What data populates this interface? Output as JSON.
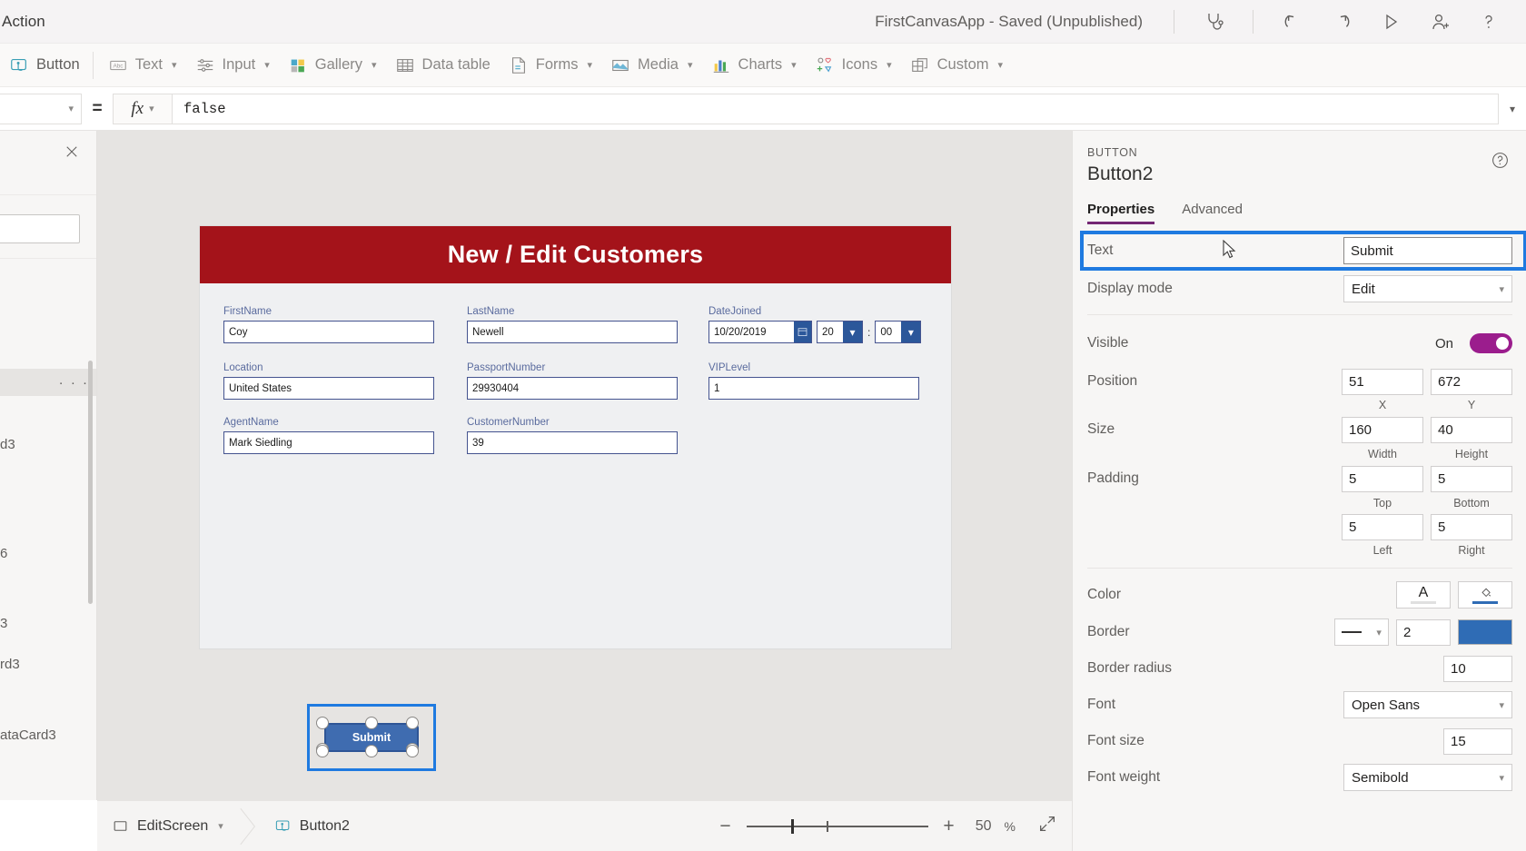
{
  "topbar": {
    "menu_action": "Action",
    "app_title": "FirstCanvasApp - Saved (Unpublished)",
    "icons": [
      {
        "name": "app-checker-icon",
        "label": "App checker"
      },
      {
        "name": "undo-icon",
        "label": "Undo"
      },
      {
        "name": "redo-icon",
        "label": "Redo"
      },
      {
        "name": "preview-play-icon",
        "label": "Preview the app"
      },
      {
        "name": "share-user-icon",
        "label": "Share"
      },
      {
        "name": "help-icon",
        "label": "Help"
      }
    ]
  },
  "ribbon": {
    "items": [
      {
        "label": "Button",
        "icon": "button-icon",
        "caret": false
      },
      {
        "label": "Text",
        "icon": "text-abc-icon",
        "caret": true
      },
      {
        "label": "Input",
        "icon": "input-sliders-icon",
        "caret": true
      },
      {
        "label": "Gallery",
        "icon": "gallery-grid-icon",
        "caret": true
      },
      {
        "label": "Data table",
        "icon": "data-table-icon",
        "caret": false
      },
      {
        "label": "Forms",
        "icon": "forms-icon",
        "caret": true
      },
      {
        "label": "Media",
        "icon": "media-image-icon",
        "caret": true
      },
      {
        "label": "Charts",
        "icon": "charts-bar-icon",
        "caret": true
      },
      {
        "label": "Icons",
        "icon": "icons-shapes-icon",
        "caret": true
      },
      {
        "label": "Custom",
        "icon": "custom-blocks-icon",
        "caret": true
      }
    ]
  },
  "formula_bar": {
    "property": "",
    "equals": "=",
    "fx_label": "fx",
    "value": "false"
  },
  "left_pane": {
    "rows": [
      {
        "label": "",
        "selected": false
      },
      {
        "label": "",
        "selected": true,
        "overflow": "· · ·"
      },
      {
        "label": "d3",
        "selected": false
      },
      {
        "label": "6",
        "selected": false
      },
      {
        "label": "3",
        "selected": false
      },
      {
        "label": "rd3",
        "selected": false
      },
      {
        "label": "ataCard3",
        "selected": false
      }
    ]
  },
  "canvas": {
    "form_title": "New / Edit Customers",
    "header_color": "#a4131a",
    "fields": [
      {
        "label": "FirstName",
        "value": "Coy",
        "type": "text",
        "col": 0,
        "row": 0
      },
      {
        "label": "LastName",
        "value": "Newell",
        "type": "text",
        "col": 1,
        "row": 0
      },
      {
        "label": "DateJoined",
        "value": "10/20/2019",
        "type": "datetime",
        "hour": "20",
        "minute": "00",
        "separator": ":",
        "col": 2,
        "row": 0
      },
      {
        "label": "Location",
        "value": "United States",
        "type": "text",
        "col": 0,
        "row": 1
      },
      {
        "label": "PassportNumber",
        "value": "29930404",
        "type": "text",
        "col": 1,
        "row": 1
      },
      {
        "label": "VIPLevel",
        "value": "1",
        "type": "text",
        "col": 2,
        "row": 1
      },
      {
        "label": "AgentName",
        "value": "Mark Siedling",
        "type": "text",
        "col": 0,
        "row": 2
      },
      {
        "label": "CustomerNumber",
        "value": "39",
        "type": "text",
        "col": 1,
        "row": 2
      }
    ],
    "submit_button": {
      "label": "Submit",
      "fill": "#3f6cb0",
      "selection_color": "#1f7ae0"
    }
  },
  "status_bar": {
    "screen_name": "EditScreen",
    "control_name": "Button2",
    "zoom_value": "50",
    "zoom_unit": "%",
    "minus": "−",
    "plus": "+"
  },
  "properties_panel": {
    "kicker": "BUTTON",
    "title": "Button2",
    "tabs": [
      {
        "label": "Properties",
        "active": true
      },
      {
        "label": "Advanced",
        "active": false
      }
    ],
    "text_row": {
      "label": "Text",
      "value": "Submit",
      "highlighted": true
    },
    "display_mode": {
      "label": "Display mode",
      "value": "Edit"
    },
    "visible": {
      "label": "Visible",
      "state_label": "On",
      "on": true,
      "accent": "#9b1d8d"
    },
    "position": {
      "label": "Position",
      "x": "51",
      "y": "672",
      "x_caption": "X",
      "y_caption": "Y"
    },
    "size": {
      "label": "Size",
      "width": "160",
      "height": "40",
      "width_caption": "Width",
      "height_caption": "Height"
    },
    "padding": {
      "label": "Padding",
      "top": "5",
      "bottom": "5",
      "left": "5",
      "right": "5",
      "top_caption": "Top",
      "bottom_caption": "Bottom",
      "left_caption": "Left",
      "right_caption": "Right"
    },
    "color": {
      "label": "Color",
      "text_glyph": "A",
      "fill_swatch": "#2f6cb5"
    },
    "border": {
      "label": "Border",
      "style": "solid",
      "width": "2",
      "color": "#2f6cb5"
    },
    "border_radius": {
      "label": "Border radius",
      "value": "10"
    },
    "font": {
      "label": "Font",
      "value": "Open Sans"
    },
    "font_size": {
      "label": "Font size",
      "value": "15"
    },
    "font_weight": {
      "label": "Font weight",
      "value": "Semibold"
    }
  }
}
